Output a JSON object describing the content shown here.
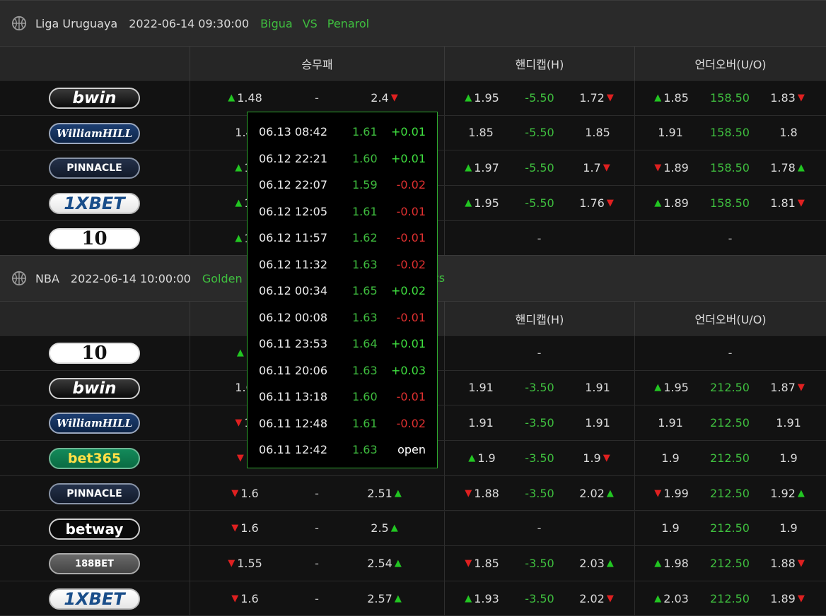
{
  "colors": {
    "green": "#3fbf3f",
    "up": "#22c622",
    "down": "#e02020",
    "popup_border": "#2ea82e"
  },
  "section1": {
    "league": "Liga Uruguaya",
    "datetime": "2022-06-14 09:30:00",
    "home": "Bigua",
    "vs": "VS",
    "away": "Penarol",
    "headers": {
      "h2h": "승무패",
      "handicap": "핸디캡(H)",
      "ou": "언더오버(U/O)"
    }
  },
  "section2": {
    "league": "NBA",
    "datetime": "2022-06-14 10:00:00",
    "home": "Golden",
    "away": "cs",
    "headers": {
      "handicap": "핸디캡(H)",
      "ou": "언더오버(U/O)"
    }
  },
  "rows1": [
    {
      "book": "bwin",
      "h": "1.48",
      "ha": "up",
      "dr": "-",
      "a": "2.4",
      "aa": "dn",
      "hc1": "1.95",
      "hc1a": "up",
      "hcl": "-5.50",
      "hc2": "1.72",
      "hc2a": "dn",
      "o1": "1.85",
      "o1a": "up",
      "ol": "158.50",
      "o2": "1.83",
      "o2a": "dn"
    },
    {
      "book": "WilliamHILL",
      "h": "1.4",
      "ha": "",
      "hc1": "1.85",
      "hc1a": "",
      "hcl": "-5.50",
      "hc2": "1.85",
      "hc2a": "",
      "o1": "1.91",
      "o1a": "",
      "ol": "158.50",
      "o2": "1.8",
      "o2a": ""
    },
    {
      "book": "PINNACLE",
      "h": "1.",
      "ha": "up",
      "hc1": "1.97",
      "hc1a": "up",
      "hcl": "-5.50",
      "hc2": "1.7",
      "hc2a": "dn",
      "o1": "1.89",
      "o1a": "dn",
      "ol": "158.50",
      "o2": "1.78",
      "o2a": "up"
    },
    {
      "book": "1XBET",
      "h": "1.",
      "ha": "up",
      "hc1": "1.95",
      "hc1a": "up",
      "hcl": "-5.50",
      "hc2": "1.76",
      "hc2a": "dn",
      "o1": "1.89",
      "o1a": "up",
      "ol": "158.50",
      "o2": "1.81",
      "o2a": "dn"
    },
    {
      "book": "10",
      "h": "1.",
      "ha": "up",
      "hcdash": "-",
      "oudash": "-"
    }
  ],
  "rows2": [
    {
      "book": "10",
      "h": "1",
      "ha": "up",
      "hcdash": "-",
      "oudash": "-"
    },
    {
      "book": "bwin",
      "h": "1.6",
      "ha": "",
      "hc1": "1.91",
      "hc1a": "",
      "hcl": "-3.50",
      "hc2": "1.91",
      "hc2a": "",
      "o1": "1.95",
      "o1a": "up",
      "ol": "212.50",
      "o2": "1.87",
      "o2a": "dn"
    },
    {
      "book": "WilliamHILL",
      "h": "1.",
      "ha": "dn",
      "hc1": "1.91",
      "hc1a": "",
      "hcl": "-3.50",
      "hc2": "1.91",
      "hc2a": "",
      "o1": "1.91",
      "o1a": "",
      "ol": "212.50",
      "o2": "1.91",
      "o2a": ""
    },
    {
      "book": "bet365",
      "h": "1",
      "ha": "dn",
      "hc1": "1.9",
      "hc1a": "up",
      "hcl": "-3.50",
      "hc2": "1.9",
      "hc2a": "dn",
      "o1": "1.9",
      "o1a": "",
      "ol": "212.50",
      "o2": "1.9",
      "o2a": ""
    },
    {
      "book": "PINNACLE",
      "h": "1.6",
      "ha": "dn",
      "dr": "-",
      "a": "2.51",
      "aa": "up",
      "hc1": "1.88",
      "hc1a": "dn",
      "hcl": "-3.50",
      "hc2": "2.02",
      "hc2a": "up",
      "o1": "1.99",
      "o1a": "dn",
      "ol": "212.50",
      "o2": "1.92",
      "o2a": "up"
    },
    {
      "book": "betway",
      "h": "1.6",
      "ha": "dn",
      "dr": "-",
      "a": "2.5",
      "aa": "up",
      "hcdash": "-",
      "o1": "1.9",
      "o1a": "",
      "ol": "212.50",
      "o2": "1.9",
      "o2a": ""
    },
    {
      "book": "188BET",
      "h": "1.55",
      "ha": "dn",
      "dr": "-",
      "a": "2.54",
      "aa": "up",
      "hc1": "1.85",
      "hc1a": "dn",
      "hcl": "-3.50",
      "hc2": "2.03",
      "hc2a": "up",
      "o1": "1.98",
      "o1a": "up",
      "ol": "212.50",
      "o2": "1.88",
      "o2a": "dn"
    },
    {
      "book": "1XBET",
      "h": "1.6",
      "ha": "dn",
      "dr": "-",
      "a": "2.57",
      "aa": "up",
      "hc1": "1.93",
      "hc1a": "up",
      "hcl": "-3.50",
      "hc2": "2.02",
      "hc2a": "dn",
      "o1": "2.03",
      "o1a": "up",
      "ol": "212.50",
      "o2": "1.89",
      "o2a": "dn"
    }
  ],
  "popup": [
    {
      "time": "06.13 08:42",
      "value": "1.61",
      "change": "+0.01",
      "kind": "pos"
    },
    {
      "time": "06.12 22:21",
      "value": "1.60",
      "change": "+0.01",
      "kind": "pos"
    },
    {
      "time": "06.12 22:07",
      "value": "1.59",
      "change": "-0.02",
      "kind": "neg"
    },
    {
      "time": "06.12 12:05",
      "value": "1.61",
      "change": "-0.01",
      "kind": "neg"
    },
    {
      "time": "06.12 11:57",
      "value": "1.62",
      "change": "-0.01",
      "kind": "neg"
    },
    {
      "time": "06.12 11:32",
      "value": "1.63",
      "change": "-0.02",
      "kind": "neg"
    },
    {
      "time": "06.12 00:34",
      "value": "1.65",
      "change": "+0.02",
      "kind": "pos"
    },
    {
      "time": "06.12 00:08",
      "value": "1.63",
      "change": "-0.01",
      "kind": "neg"
    },
    {
      "time": "06.11 23:53",
      "value": "1.64",
      "change": "+0.01",
      "kind": "pos"
    },
    {
      "time": "06.11 20:06",
      "value": "1.63",
      "change": "+0.03",
      "kind": "pos"
    },
    {
      "time": "06.11 13:18",
      "value": "1.60",
      "change": "-0.01",
      "kind": "neg"
    },
    {
      "time": "06.11 12:48",
      "value": "1.61",
      "change": "-0.02",
      "kind": "neg"
    },
    {
      "time": "06.11 12:42",
      "value": "1.63",
      "change": "open",
      "kind": "open"
    }
  ]
}
